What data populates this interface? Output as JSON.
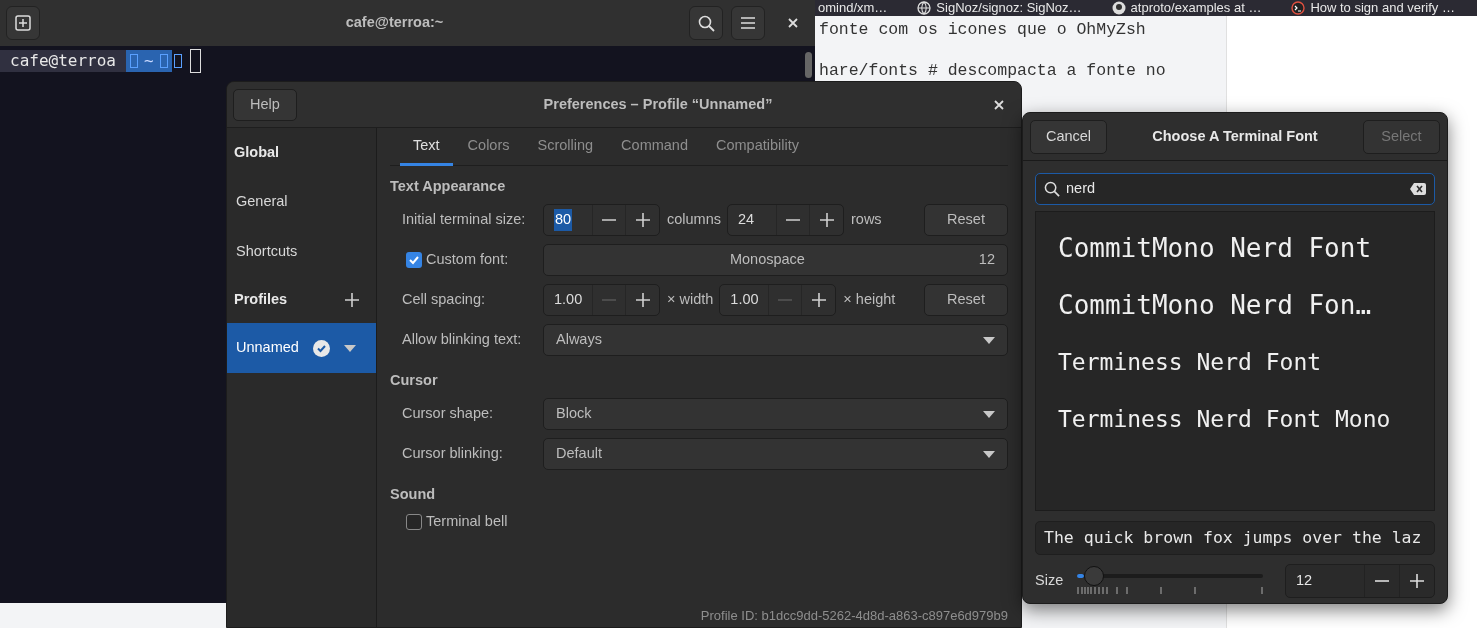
{
  "browser": {
    "tabs": [
      {
        "title": "omind/xm…"
      },
      {
        "title": "SigNoz/signoz: SigNoz…"
      },
      {
        "title": "atproto/examples at …"
      },
      {
        "title": "How to sign and verify …"
      }
    ],
    "page_lines": [
      "fonte com os icones que o OhMyZsh",
      "hare/fonts # descompacta a fonte no"
    ]
  },
  "terminal": {
    "title": "cafe@terroa:~",
    "prompt": {
      "host": "cafe@terroa",
      "path": "~"
    }
  },
  "preferences": {
    "help": "Help",
    "title": "Preferences – Profile “Unnamed”",
    "sidebar": [
      {
        "kind": "heading",
        "label": "Global",
        "selected": false
      },
      {
        "kind": "item",
        "label": "General",
        "selected": false
      },
      {
        "kind": "item",
        "label": "Shortcuts",
        "selected": false
      },
      {
        "kind": "heading_add",
        "label": "Profiles",
        "selected": false
      },
      {
        "kind": "profile",
        "label": "Unnamed",
        "selected": true
      }
    ],
    "tabs": [
      {
        "label": "Text",
        "selected": true
      },
      {
        "label": "Colors",
        "selected": false
      },
      {
        "label": "Scrolling",
        "selected": false
      },
      {
        "label": "Command",
        "selected": false
      },
      {
        "label": "Compatibility",
        "selected": false
      }
    ],
    "sections": [
      {
        "title": "Text Appearance",
        "rows": [
          {
            "kind": "spins",
            "label": "Initial terminal size:",
            "spins": [
              {
                "value": "80",
                "value_selected": true,
                "minus_disabled": false,
                "unit": "columns"
              },
              {
                "value": "24",
                "value_selected": false,
                "minus_disabled": false,
                "unit": "rows"
              }
            ],
            "reset": "Reset"
          },
          {
            "kind": "font",
            "label": "Custom font:",
            "checked": true,
            "font": "Monospace",
            "size": "12"
          },
          {
            "kind": "spins",
            "label": "Cell spacing:",
            "spins": [
              {
                "value": "1.00",
                "value_selected": false,
                "minus_disabled": true,
                "unit": "× width"
              },
              {
                "value": "1.00",
                "value_selected": false,
                "minus_disabled": true,
                "unit": "× height"
              }
            ],
            "reset": "Reset"
          },
          {
            "kind": "dropdown",
            "label": "Allow blinking text:",
            "value": "Always"
          }
        ]
      },
      {
        "title": "Cursor",
        "rows": [
          {
            "kind": "dropdown",
            "label": "Cursor shape:",
            "value": "Block"
          },
          {
            "kind": "dropdown",
            "label": "Cursor blinking:",
            "value": "Default"
          }
        ]
      },
      {
        "title": "Sound",
        "rows": [
          {
            "kind": "checkbox",
            "label": "Terminal bell",
            "checked": false
          }
        ]
      }
    ],
    "profile_id": "Profile ID: b1dcc9dd-5262-4d8d-a863-c897e6d979b9"
  },
  "font_chooser": {
    "cancel": "Cancel",
    "title": "Choose A Terminal Font",
    "select": "Select",
    "select_disabled": true,
    "search": "nerd",
    "fonts": [
      {
        "name": "CommitMono Nerd Font",
        "selected": false
      },
      {
        "name": "CommitMono Nerd Fon…",
        "selected": false
      },
      {
        "name": "Terminess Nerd Font",
        "selected": false
      },
      {
        "name": "Terminess Nerd Font Mono",
        "selected": false
      }
    ],
    "preview": "The quick brown fox jumps over the laz",
    "size_label": "Size",
    "size": {
      "level": 0.09,
      "value": "12"
    }
  }
}
